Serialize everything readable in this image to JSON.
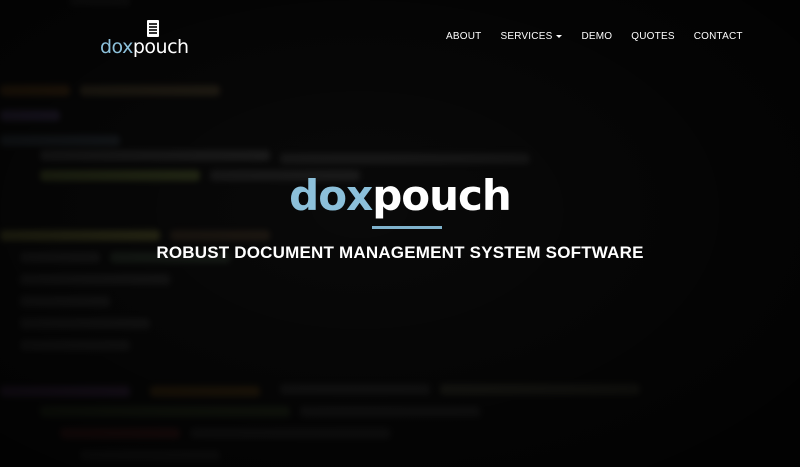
{
  "brand": {
    "logo_part1": "dox",
    "logo_part2": "pouch"
  },
  "nav": {
    "items": [
      {
        "label": "ABOUT"
      },
      {
        "label": "SERVICES",
        "has_dropdown": true
      },
      {
        "label": "DEMO"
      },
      {
        "label": "QUOTES"
      },
      {
        "label": "CONTACT"
      }
    ]
  },
  "hero": {
    "title_part1": "dox",
    "title_part2": "pouch",
    "subtitle": "ROBUST DOCUMENT MANAGEMENT SYSTEM SOFTWARE"
  },
  "colors": {
    "accent": "#8cc0da",
    "text": "#ffffff",
    "background": "#0e0e0e"
  }
}
